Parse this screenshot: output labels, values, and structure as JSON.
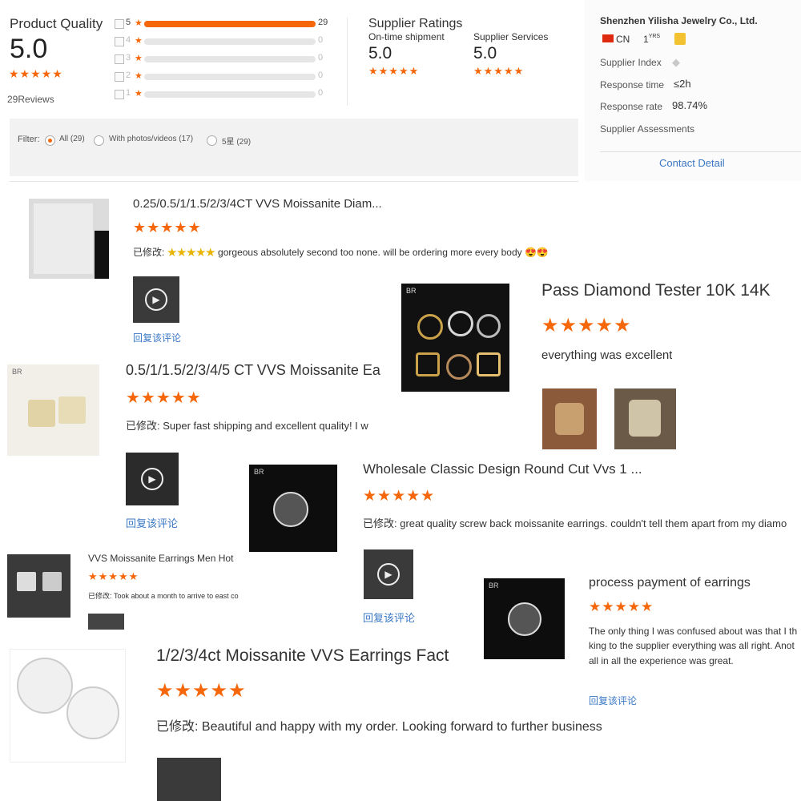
{
  "rating_summary": {
    "title": "Product Quality",
    "score": "5.0",
    "stars": "★★★★★",
    "reviews_count": "29",
    "reviews_label": "Reviews",
    "bars": [
      {
        "star": "5",
        "count": "29",
        "fill": 1.0
      },
      {
        "star": "4",
        "count": "0",
        "fill": 0
      },
      {
        "star": "3",
        "count": "0",
        "fill": 0
      },
      {
        "star": "2",
        "count": "0",
        "fill": 0
      },
      {
        "star": "1",
        "count": "0",
        "fill": 0
      }
    ],
    "star_glyph": "★"
  },
  "supplier_ratings": {
    "title": "Supplier Ratings",
    "ontime_label": "On-time shipment",
    "ontime_score": "5.0",
    "services_label": "Supplier Services",
    "services_score": "5.0",
    "stars": "★★★★★"
  },
  "supplier_card": {
    "name": "Shenzhen Yilisha Jewelry Co., Ltd.",
    "country": "CN",
    "years_num": "1",
    "years_unit": "YRS",
    "index_label": "Supplier Index",
    "response_time_label": "Response time",
    "response_time_value": "≤2h",
    "response_rate_label": "Response rate",
    "response_rate_value": "98.74%",
    "assessments_label": "Supplier Assessments",
    "contact_label": "Contact Detail"
  },
  "filter": {
    "label": "Filter:",
    "options": [
      "All (29)",
      "With photos/videos (17)",
      "5星 (29)"
    ]
  },
  "reviews": [
    {
      "title": "0.25/0.5/1/1.5/2/3/4CT VVS Moissanite Diam...",
      "stars": "★★★★★",
      "modified_label": "已修改:",
      "text": "gorgeous absolutely second too none. will be ordering more every body 😍😍",
      "inline_stars": "★★★★★",
      "reply": "回复该评论"
    },
    {
      "title": "Pass Diamond Tester 10K 14K",
      "stars": "★★★★★",
      "text": "everything was excellent"
    },
    {
      "title": "0.5/1/1.5/2/3/4/5 CT VVS Moissanite Ea",
      "stars": "★★★★★",
      "modified_label": "已修改:",
      "text": "Super fast shipping and excellent quality! I w",
      "reply": "回复该评论"
    },
    {
      "title": "Wholesale Classic Design Round Cut Vvs 1 ...",
      "stars": "★★★★★",
      "modified_label": "已修改:",
      "text": "great quality screw back moissanite earrings. couldn't tell them apart from my diamo",
      "reply": "回复该评论"
    },
    {
      "title": "VVS Moissanite Earrings Men Hot",
      "stars": "★★★★★",
      "modified_label": "已修改:",
      "text": "Took about a month to arrive to east co"
    },
    {
      "title": "process payment of earrings",
      "stars": "★★★★★",
      "lines": [
        "The only thing I was confused about was that I th",
        "king to the supplier everything was all right. Anot",
        "all in all the experience was great."
      ],
      "reply": "回复该评论"
    },
    {
      "title": "1/2/3/4ct Moissanite VVS Earrings Fact",
      "stars": "★★★★★",
      "modified_label": "已修改:",
      "text": "Beautiful and happy with my order. Looking forward to further business"
    }
  ],
  "logo_text": "BR",
  "colors": {
    "accent": "#f5670a",
    "link": "#3b78c4"
  }
}
